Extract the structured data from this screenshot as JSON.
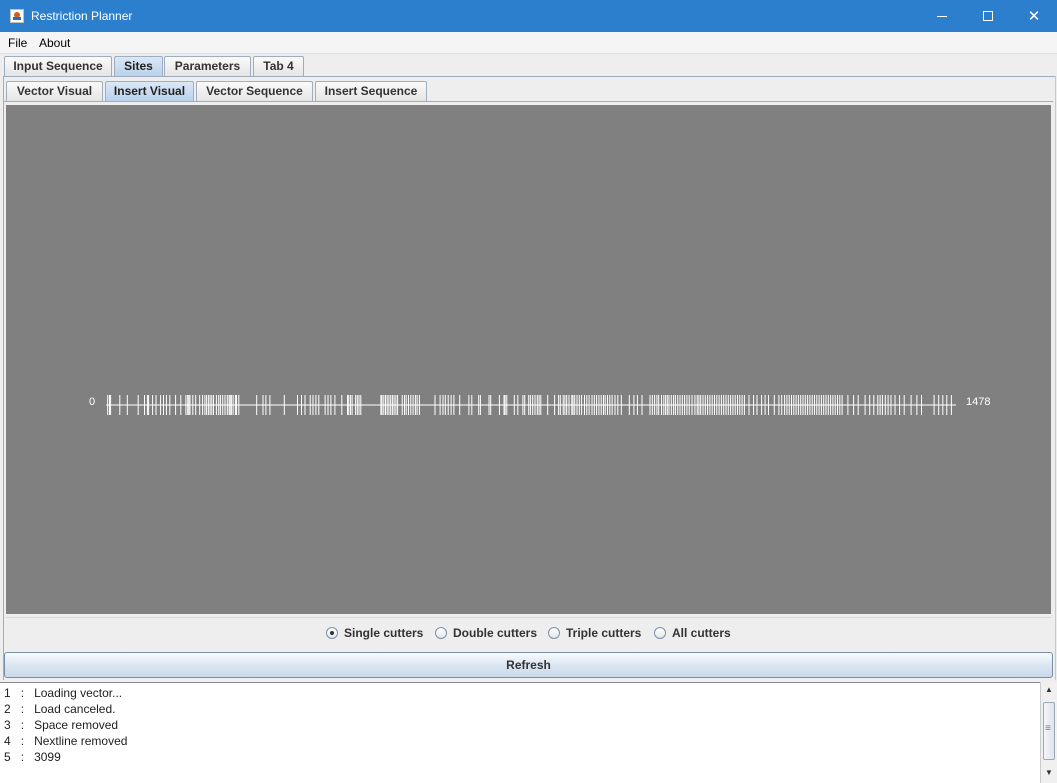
{
  "window": {
    "title": "Restriction Planner"
  },
  "menu": {
    "items": [
      "File",
      "About"
    ]
  },
  "main_tabs": [
    {
      "label": "Input Sequence",
      "selected": false
    },
    {
      "label": "Sites",
      "selected": true
    },
    {
      "label": "Parameters",
      "selected": false
    },
    {
      "label": "Tab 4",
      "selected": false
    }
  ],
  "sub_tabs": [
    {
      "label": "Vector Visual",
      "selected": false
    },
    {
      "label": "Insert Visual",
      "selected": true
    },
    {
      "label": "Vector Sequence",
      "selected": false
    },
    {
      "label": "Insert Sequence",
      "selected": false
    }
  ],
  "visual": {
    "start_label": "0",
    "end_label": "1478",
    "sequence_length": 1478,
    "background_color": "#808080",
    "line_color": "#ffffff",
    "site_positions": [
      3,
      6,
      8,
      24,
      37,
      56,
      67,
      72,
      74,
      81,
      87,
      95,
      100,
      105,
      111,
      121,
      130,
      139,
      142,
      144,
      146,
      151,
      156,
      163,
      168,
      172,
      175,
      178,
      181,
      184,
      187,
      192,
      196,
      199,
      203,
      207,
      211,
      214,
      216,
      218,
      221,
      225,
      227,
      231,
      262,
      273,
      278,
      285,
      310,
      333,
      340,
      346,
      355,
      360,
      365,
      370,
      381,
      386,
      391,
      398,
      410,
      420,
      422,
      425,
      428,
      434,
      437,
      440,
      443,
      478,
      480,
      483,
      486,
      489,
      492,
      495,
      498,
      501,
      504,
      507,
      515,
      519,
      522,
      526,
      530,
      534,
      538,
      541,
      545,
      572,
      581,
      586,
      590,
      595,
      600,
      605,
      615,
      631,
      636,
      648,
      651,
      666,
      669,
      684,
      692,
      694,
      697,
      710,
      716,
      725,
      728,
      735,
      738,
      742,
      746,
      750,
      753,
      756,
      768,
      780,
      787,
      790,
      795,
      798,
      801,
      805,
      810,
      812,
      815,
      819,
      823,
      827,
      832,
      836,
      840,
      845,
      849,
      853,
      857,
      861,
      865,
      868,
      872,
      876,
      880,
      885,
      890,
      896,
      910,
      918,
      924,
      932,
      946,
      950,
      954,
      958,
      961,
      966,
      970,
      973,
      976,
      979,
      983,
      987,
      990,
      994,
      998,
      1002,
      1006,
      1010,
      1014,
      1019,
      1024,
      1028,
      1031,
      1034,
      1038,
      1042,
      1046,
      1050,
      1054,
      1058,
      1062,
      1066,
      1070,
      1074,
      1078,
      1082,
      1086,
      1090,
      1094,
      1098,
      1102,
      1106,
      1110,
      1118,
      1126,
      1132,
      1140,
      1146,
      1152,
      1162,
      1170,
      1175,
      1180,
      1184,
      1188,
      1192,
      1196,
      1200,
      1204,
      1208,
      1212,
      1216,
      1220,
      1224,
      1228,
      1232,
      1236,
      1240,
      1244,
      1248,
      1252,
      1256,
      1260,
      1264,
      1268,
      1272,
      1276,
      1280,
      1290,
      1300,
      1308,
      1320,
      1328,
      1335,
      1342,
      1346,
      1350,
      1355,
      1360,
      1365,
      1372,
      1380,
      1388,
      1400,
      1410,
      1418,
      1440,
      1448,
      1455,
      1462,
      1470
    ]
  },
  "radio_options": [
    {
      "label": "Single cutters",
      "selected": true
    },
    {
      "label": "Double cutters",
      "selected": false
    },
    {
      "label": "Triple cutters",
      "selected": false
    },
    {
      "label": "All cutters",
      "selected": false
    }
  ],
  "refresh_label": "Refresh",
  "log": [
    {
      "num": "1",
      "sep": ":",
      "text": "Loading vector..."
    },
    {
      "num": "2",
      "sep": ":",
      "text": "Load canceled."
    },
    {
      "num": "3",
      "sep": ":",
      "text": "Space removed"
    },
    {
      "num": "4",
      "sep": ":",
      "text": "Nextline removed"
    },
    {
      "num": "5",
      "sep": ":",
      "text": "3099"
    }
  ]
}
